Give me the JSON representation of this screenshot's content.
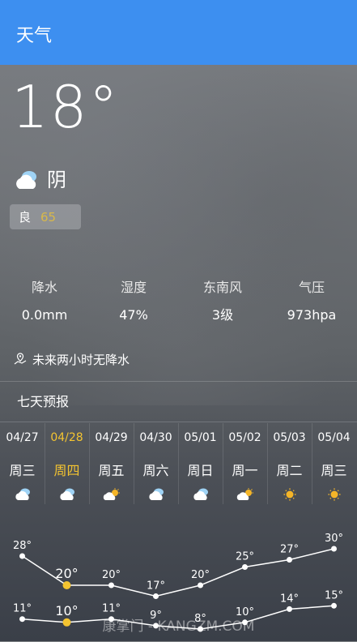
{
  "appbar": {
    "title": "天气"
  },
  "current": {
    "temperature": "18°",
    "condition": "阴",
    "condition_icon": "cloudy-icon",
    "aqi_label": "良",
    "aqi_value": "65",
    "aqi_color": "#d8b84a"
  },
  "stats": [
    {
      "label": "降水",
      "value": "0.0mm"
    },
    {
      "label": "湿度",
      "value": "47%"
    },
    {
      "label": "东南风",
      "value": "3级"
    },
    {
      "label": "气压",
      "value": "973hpa"
    }
  ],
  "rain_note": "未来两小时无降水",
  "forecast": {
    "title": "七天预报",
    "days": [
      {
        "date": "04/27",
        "weekday": "周三",
        "icon": "cloudy",
        "high": "28°",
        "low": "11°",
        "high_value": 28,
        "low_value": 11,
        "active": false
      },
      {
        "date": "04/28",
        "weekday": "周四",
        "icon": "cloudy",
        "high": "20°",
        "low": "10°",
        "high_value": 20,
        "low_value": 10,
        "active": true
      },
      {
        "date": "04/29",
        "weekday": "周五",
        "icon": "partly-sunny",
        "high": "20°",
        "low": "11°",
        "high_value": 20,
        "low_value": 11,
        "active": false
      },
      {
        "date": "04/30",
        "weekday": "周六",
        "icon": "cloudy",
        "high": "17°",
        "low": "9°",
        "high_value": 17,
        "low_value": 9,
        "active": false
      },
      {
        "date": "05/01",
        "weekday": "周日",
        "icon": "cloudy",
        "high": "20°",
        "low": "8°",
        "high_value": 20,
        "low_value": 8,
        "active": false
      },
      {
        "date": "05/02",
        "weekday": "周一",
        "icon": "partly-sunny",
        "high": "25°",
        "low": "10°",
        "high_value": 25,
        "low_value": 10,
        "active": false
      },
      {
        "date": "05/03",
        "weekday": "周二",
        "icon": "sunny",
        "high": "27°",
        "low": "14°",
        "high_value": 27,
        "low_value": 14,
        "active": false
      },
      {
        "date": "05/04",
        "weekday": "周三",
        "icon": "sunny",
        "high": "30°",
        "low": "15°",
        "high_value": 30,
        "low_value": 15,
        "active": false
      }
    ]
  },
  "colors": {
    "appbar": "#3d8ff0",
    "highlight": "#f4c430"
  },
  "watermark": "康掌门 - KANGZM.COM"
}
